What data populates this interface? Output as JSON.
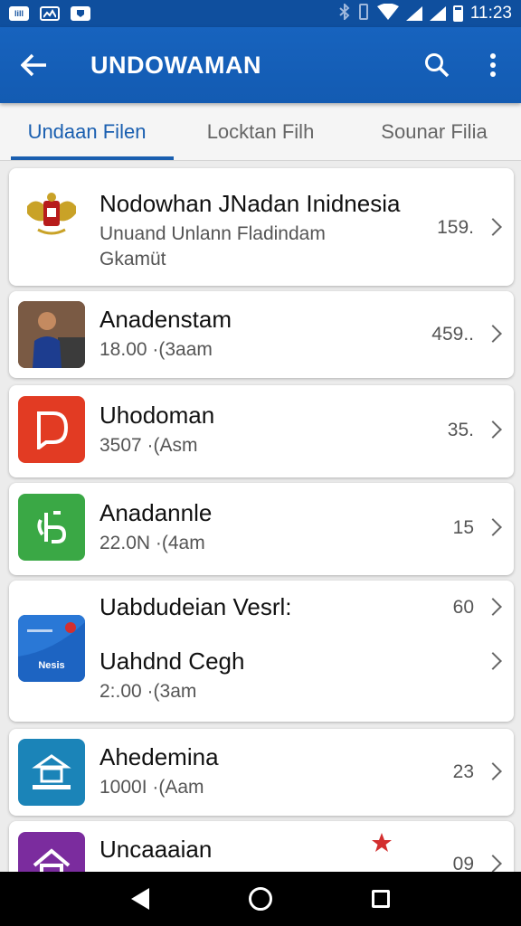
{
  "status_bar": {
    "left_icons": [
      "sim-card-icon",
      "image-icon",
      "app-notification-icon"
    ],
    "left_labels": [
      "lill",
      "",
      ""
    ],
    "time": "11:23"
  },
  "app_bar": {
    "title": "UNDOWAMAN",
    "color": "#1565c0"
  },
  "tabs": [
    {
      "label": "Undaan Filen",
      "active": true
    },
    {
      "label": "Locktan Filh",
      "active": false
    },
    {
      "label": "Sounar Filia",
      "active": false
    }
  ],
  "items": [
    {
      "name": "Nodowhan JNadan Inidnesia",
      "subtitle": "Unuand Unlann Fladindam",
      "subtitle2": "Gkamüt",
      "count": "159.",
      "icon": "emblem-icon"
    },
    {
      "name": "Anadenstam",
      "subtitle": "18.00 ·(3aam",
      "count": "459..",
      "icon": "person-photo-icon"
    },
    {
      "name": "Uhodoman",
      "subtitle": "3507 ·(Asm",
      "count": "35.",
      "icon": "red-d-app-icon"
    },
    {
      "name": "Anadannle",
      "subtitle": "22.0N ·(4am",
      "count": "15",
      "icon": "green-app-icon"
    },
    {
      "name": "Uabdudeian Vesrl:",
      "count": "60",
      "name2": "Uahdnd Cegh",
      "subtitle": "2:.00 ·(3am",
      "icon": "blue-card-app-icon",
      "thumb_text": "Nesis"
    },
    {
      "name": "Ahedemina",
      "subtitle": "1000I ·(Aam",
      "count": "23",
      "icon": "blue-bank-app-icon"
    },
    {
      "name": "Uncaaaian",
      "count": "09",
      "icon": "purple-house-app-icon",
      "badge_icon": "red-star-icon"
    }
  ]
}
